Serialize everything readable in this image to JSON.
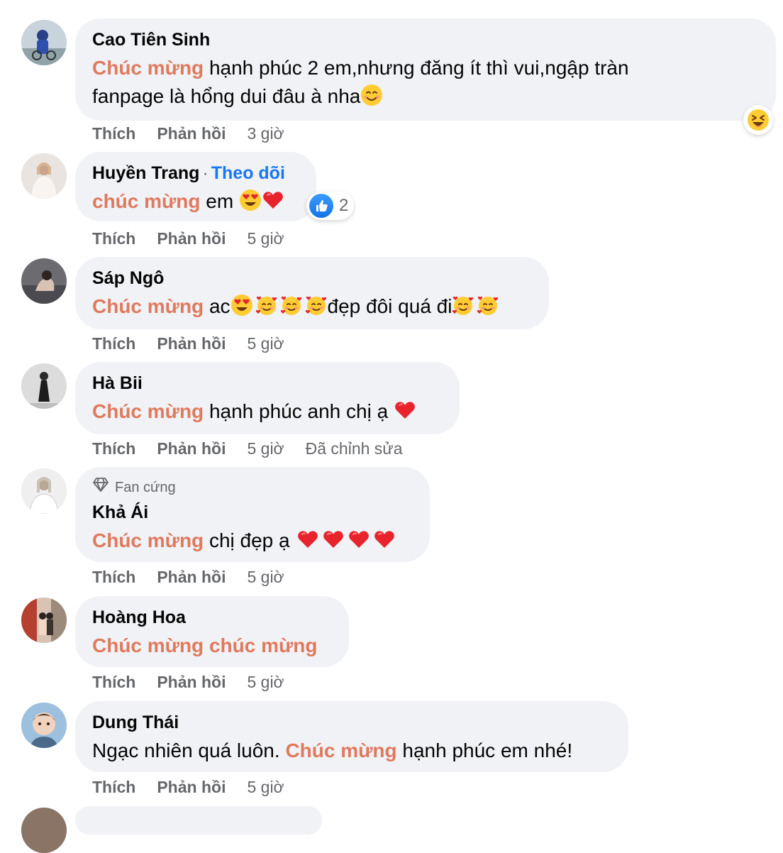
{
  "actions": {
    "like": "Thích",
    "reply": "Phản hồi"
  },
  "comments": [
    {
      "author": "Cao Tiên Sinh",
      "highlight": "Chúc mừng",
      "text_1": " hạnh phúc 2 em,nhưng đăng ít thì vui,ngập tràn",
      "text_2": "fanpage là hổng dui đâu à nha",
      "emoji": "smiling-face-icon",
      "reaction": "laughing-face-icon",
      "time": "3 giờ"
    },
    {
      "author": "Huyền Trang",
      "follow_label": "Theo dõi",
      "highlight": "chúc mừng",
      "text_1": " em ",
      "emojis": [
        "heart-eyes-icon",
        "red-heart-icon"
      ],
      "reaction": "like-icon",
      "reaction_count": "2",
      "time": "5 giờ"
    },
    {
      "author": "Sáp Ngô",
      "highlight": "Chúc mừng",
      "text_1": " ac",
      "text_2": "đẹp đôi quá đi",
      "time": "5 giờ"
    },
    {
      "author": "Hà Bii",
      "highlight": "Chúc mừng",
      "text_1": " hạnh phúc anh chị ạ ",
      "time": "5 giờ",
      "edited": "Đã chỉnh sửa"
    },
    {
      "badge": "Fan cứng",
      "author": "Khả Ái",
      "highlight": "Chúc mừng",
      "text_1": " chị đẹp ạ ",
      "time": "5 giờ"
    },
    {
      "author": "Hoàng Hoa",
      "highlight": "Chúc mừng chúc mừng",
      "time": "5 giờ"
    },
    {
      "author": "Dung Thái",
      "text_pre": "Ngạc nhiên quá luôn. ",
      "highlight": "Chúc mừng",
      "text_post": " hạnh phúc em nhé!",
      "time": "5 giờ"
    }
  ],
  "colors": {
    "highlight": "#e07a5f",
    "bubble": "#f0f2f5",
    "follow": "#1877f2",
    "meta": "#65676b"
  }
}
